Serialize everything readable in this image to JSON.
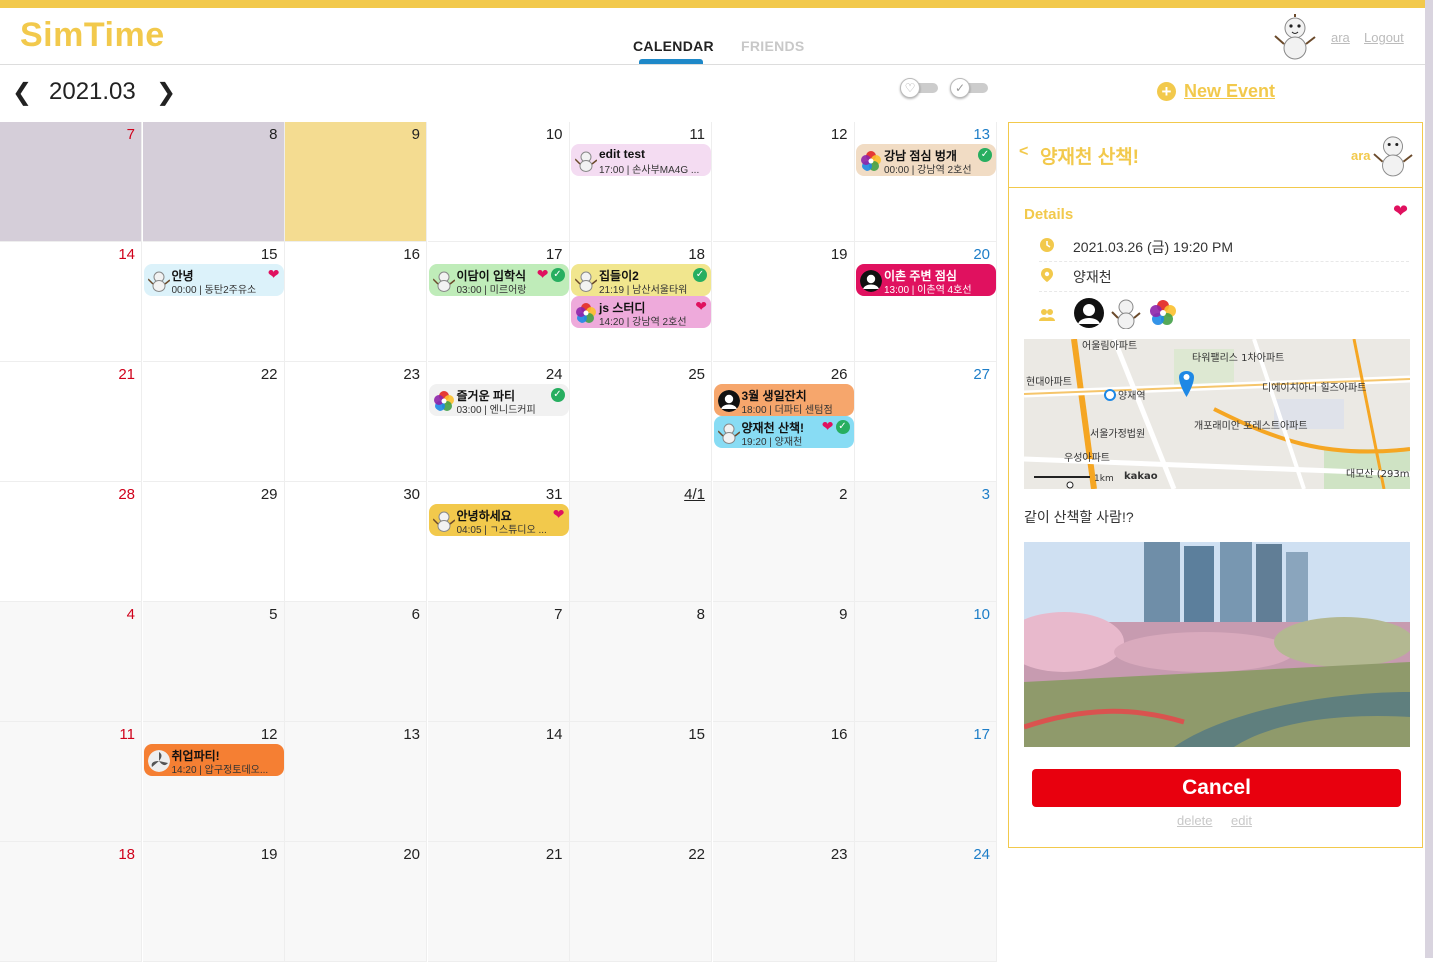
{
  "app": {
    "logo": "SimTime",
    "tabs": [
      "CALENDAR",
      "FRIENDS"
    ],
    "user": "ara",
    "logout": "Logout"
  },
  "toolbar": {
    "month": "2021.03",
    "new_event": "New Event"
  },
  "colors": {
    "brand": "#f2c94c",
    "tab_indicator": "#1e88c8",
    "sunday": "#d0021b",
    "saturday": "#1e7ec8",
    "cancel": "#e8000e",
    "heart": "#e0115f",
    "check": "#27ae60"
  },
  "calendar": {
    "days": [
      "7",
      "8",
      "9",
      "10",
      "11",
      "12",
      "13",
      "14",
      "15",
      "16",
      "17",
      "18",
      "19",
      "20",
      "21",
      "22",
      "23",
      "24",
      "25",
      "26",
      "27",
      "28",
      "29",
      "30",
      "31",
      "4/1",
      "2",
      "3",
      "4",
      "5",
      "6",
      "7",
      "8",
      "9",
      "10",
      "11",
      "12",
      "13",
      "14",
      "15",
      "16",
      "17",
      "18",
      "19",
      "20",
      "21",
      "22",
      "23",
      "24"
    ],
    "events": [
      {
        "title": "edit test",
        "sub": "17:00 | 손사부MA4G ...",
        "bg": "#f4dcf2",
        "avatar": "snowman-icon"
      },
      {
        "title": "강남 점심 벙개",
        "sub": "00:00 | 강남역 2호선",
        "bg": "#f1dcc4",
        "avatar": "colorful-icon",
        "check": true
      },
      {
        "title": "안녕",
        "sub": "00:00 | 동탄2주유소",
        "bg": "#dcf2fa",
        "avatar": "snowman-icon",
        "heart": true
      },
      {
        "title": "이담이 입학식",
        "sub": "03:00 | 미르어랑",
        "bg": "#bfecb9",
        "avatar": "snowman-icon",
        "heart": true,
        "check": true
      },
      {
        "title": "집들이2",
        "sub": "21:19 | 남산서울타워",
        "bg": "#f1e68e",
        "avatar": "snowman-icon",
        "check": true
      },
      {
        "title": "js 스터디",
        "sub": "14:20 | 강남역 2호선",
        "bg": "#eeaadb",
        "avatar": "colorful-icon",
        "heart": true
      },
      {
        "title": "이촌 주변 점심",
        "sub": "13:00 | 이촌역 4호선",
        "bg": "#e0115f",
        "avatar": "person-icon"
      },
      {
        "title": "즐거운 파티",
        "sub": "03:00 | 엔니드커피",
        "bg": "#f1f1f1",
        "avatar": "colorful-icon",
        "check": true
      },
      {
        "title": "3월 생일잔치",
        "sub": "18:00 | 더파티 센텀점",
        "bg": "#f6a66c",
        "avatar": "person-icon"
      },
      {
        "title": "양재천 산책!",
        "sub": "19:20 | 양재천",
        "bg": "#88dcf4",
        "avatar": "snowman-icon",
        "heart": true,
        "check": true
      },
      {
        "title": "안녕하세요",
        "sub": "04:05 | ㄱ스튜디오 ...",
        "bg": "#f2c94c",
        "avatar": "snowman-icon",
        "heart": true
      },
      {
        "title": "취업파티!",
        "sub": "14:20 | 압구정토데오...",
        "bg": "#f57f33",
        "avatar": "fan-icon"
      }
    ]
  },
  "detail": {
    "title": "양재천 산책!",
    "owner": "ara",
    "section": "Details",
    "datetime": "2021.03.26 (금) 19:20 PM",
    "place": "양재천",
    "description": "같이 산책할 사람!?",
    "cancel": "Cancel",
    "delete": "delete",
    "edit": "edit",
    "map_labels": [
      "어울림아파트",
      "타워팰리스 1차아파트",
      "현대아파트",
      "양재역",
      "디에이치아너 힐즈아파트",
      "서울가정법원",
      "개포래미안 포레스트아파트",
      "우성아파트",
      "대모산 (293m)",
      "1km",
      "kakao"
    ]
  }
}
